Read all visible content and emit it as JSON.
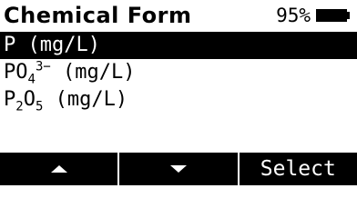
{
  "header": {
    "title": "Chemical Form",
    "battery_percent": "95%",
    "battery_level": 0.95
  },
  "list": {
    "items": [
      {
        "label": "P (mg/L)",
        "selected": true
      },
      {
        "formula_prefix": "PO",
        "formula_sub": "4",
        "formula_sup": "3−",
        "suffix": " (mg/L)",
        "selected": false
      },
      {
        "formula_p": "P",
        "formula_sub1": "2",
        "formula_o": "O",
        "formula_sub2": "5",
        "suffix": " (mg/L)",
        "selected": false
      }
    ]
  },
  "softkeys": {
    "up_icon": "arrow-up-icon",
    "down_icon": "arrow-down-icon",
    "select_label": "Select"
  },
  "colors": {
    "background": "#ffffff",
    "foreground": "#000000"
  }
}
